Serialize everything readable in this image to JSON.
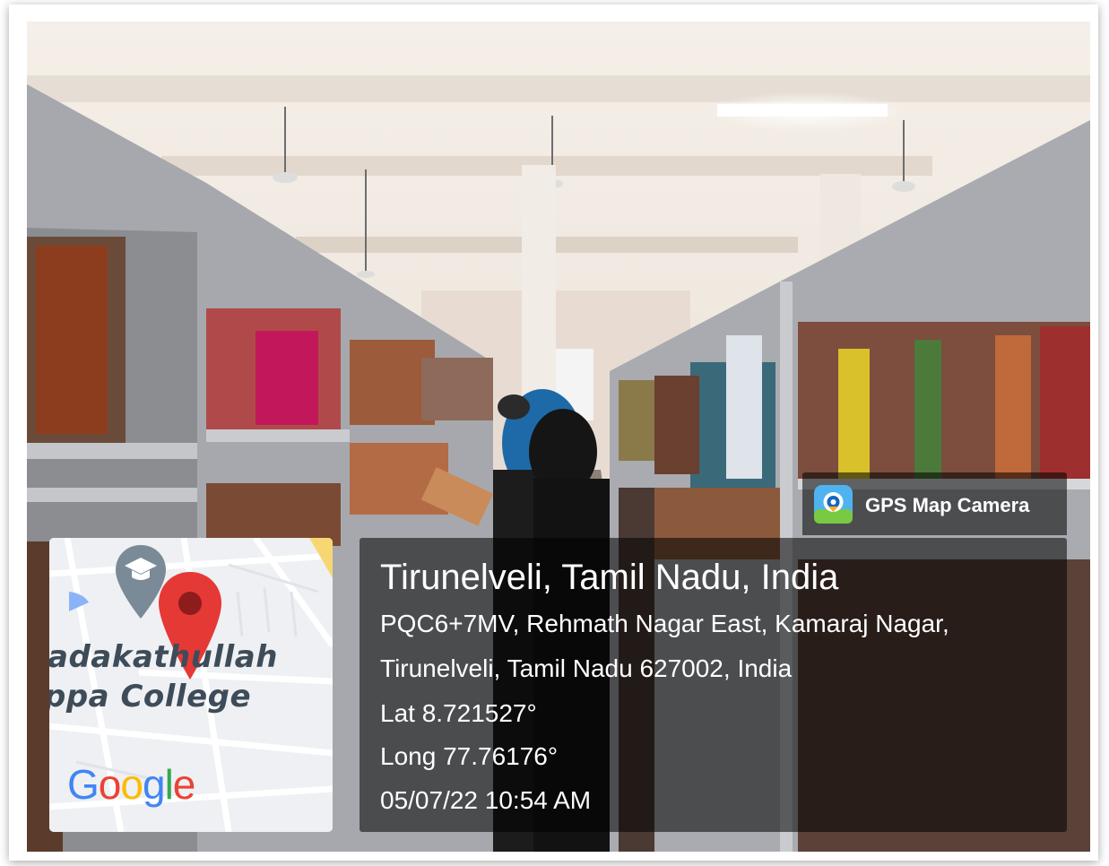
{
  "app": {
    "badge_label": "GPS Map Camera",
    "badge_icon": "gps-map-camera-icon"
  },
  "location": {
    "title": "Tirunelveli, Tamil Nadu, India",
    "address_line1": "PQC6+7MV, Rehmath Nagar East, Kamaraj Nagar,",
    "address_line2": "Tirunelveli, Tamil Nadu 627002, India",
    "lat": "Lat 8.721527°",
    "long": "Long 77.76176°",
    "datetime": "05/07/22 10:54 AM"
  },
  "map": {
    "label_line1": "adakathullah",
    "label_line2": "ppa College",
    "provider": "Google",
    "pin_icon": "map-pin-icon",
    "place_icon": "graduation-cap-icon"
  },
  "colors": {
    "overlay": "#000000",
    "text": "#ffffff",
    "pin": "#e53935",
    "google_blue": "#4285F4",
    "google_red": "#EA4335",
    "google_yellow": "#FBBC05",
    "google_green": "#34A853"
  }
}
